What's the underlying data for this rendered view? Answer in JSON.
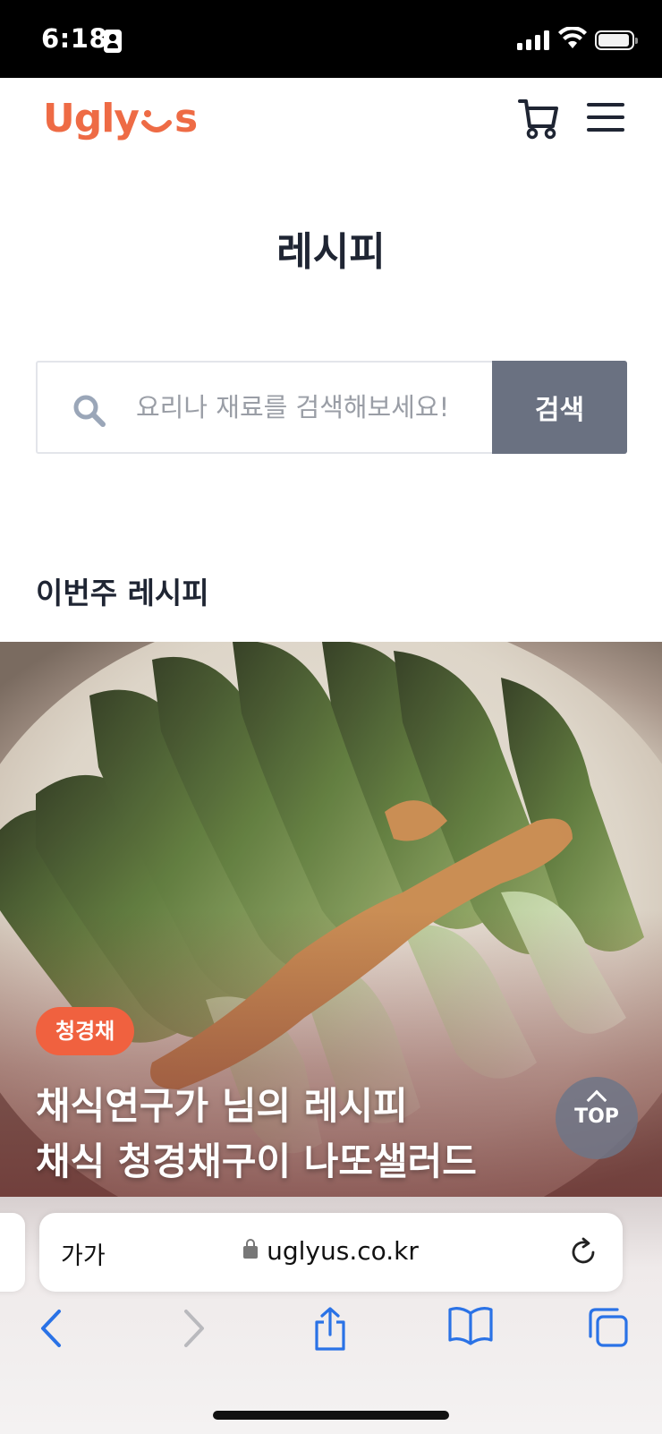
{
  "status_bar": {
    "time": "6:18"
  },
  "header": {
    "logo_text_left": "Ugly",
    "logo_text_right": "s"
  },
  "page": {
    "title": "레시피"
  },
  "search": {
    "placeholder": "요리나 재료를 검색해보세요!",
    "button_label": "검색"
  },
  "section": {
    "title": "이번주 레시피"
  },
  "recipe": {
    "tag": "청경채",
    "title_line1": "채식연구가 님의 레시피",
    "title_line2": "채식 청경채구이 나또샐러드"
  },
  "top_button": {
    "label": "TOP"
  },
  "browser": {
    "text_size_label": "가가",
    "url": "uglyus.co.kr"
  },
  "colors": {
    "brand": "#ee6b45",
    "tag": "#f0613f",
    "search_button": "#6a7181",
    "ios_blue": "#1a73e8"
  }
}
